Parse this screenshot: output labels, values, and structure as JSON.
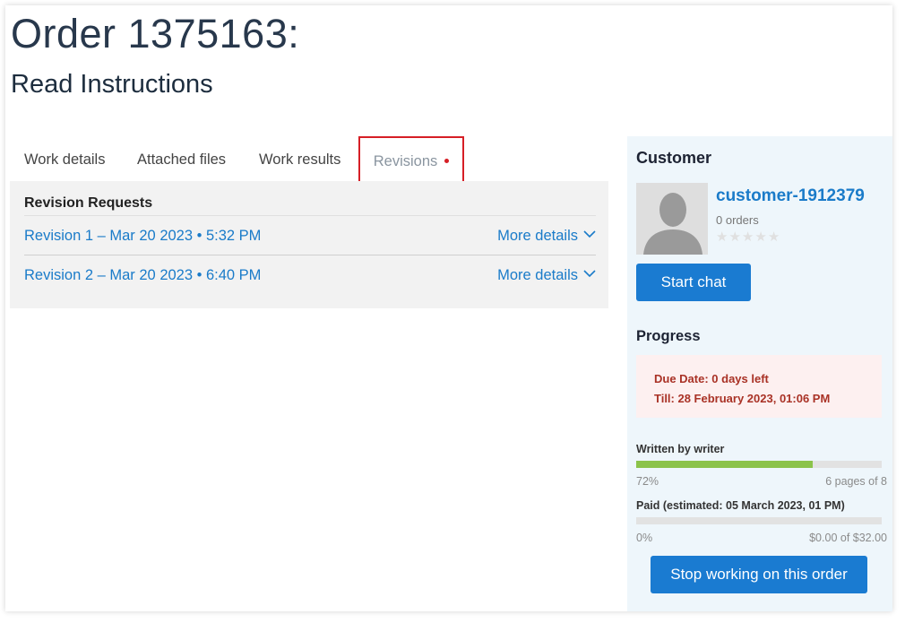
{
  "header": {
    "order_title": "Order 1375163:",
    "subtitle": "Read Instructions"
  },
  "tabs": [
    {
      "label": "Work details",
      "active": false
    },
    {
      "label": "Attached files",
      "active": false
    },
    {
      "label": "Work results",
      "active": false
    },
    {
      "label": "Revisions",
      "active": true,
      "has_notification_dot": true
    }
  ],
  "revisions": {
    "heading": "Revision Requests",
    "items": [
      {
        "label": "Revision 1 – Mar 20 2023 • 5:32 PM",
        "more": "More details"
      },
      {
        "label": "Revision 2 – Mar 20 2023 • 6:40 PM",
        "more": "More details"
      }
    ]
  },
  "customer": {
    "heading": "Customer",
    "name": "customer-1912379",
    "orders": "0 orders",
    "rating": 0,
    "rating_max": 5,
    "start_chat_label": "Start chat"
  },
  "progress": {
    "heading": "Progress",
    "due_date": "Due Date: 0 days left",
    "till": "Till: 28 February 2023, 01:06 PM",
    "written": {
      "label": "Written by writer",
      "percent_text": "72%",
      "fraction": 0.72,
      "detail": "6 pages of 8"
    },
    "paid": {
      "label": "Paid (estimated: 05 March 2023, 01 PM)",
      "percent_text": "0%",
      "fraction": 0,
      "detail": "$0.00 of $32.00"
    },
    "stop_label": "Stop working on this order"
  },
  "colors": {
    "accent": "#1a7bd1",
    "link": "#1a7bc9",
    "alert_text": "#a93226",
    "progress_fill": "#8bc34a",
    "tab_highlight": "#d61f26"
  }
}
